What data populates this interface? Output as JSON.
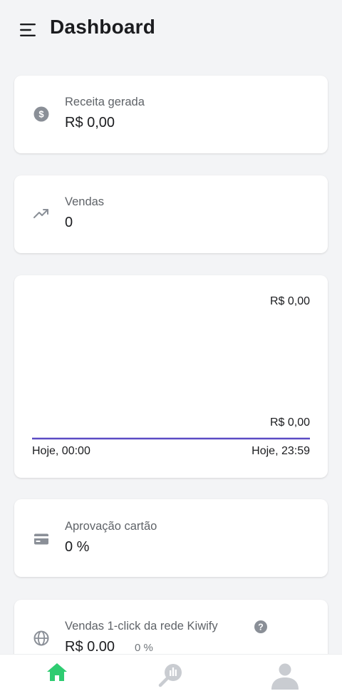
{
  "header": {
    "title": "Dashboard",
    "menu_icon": "menu-icon"
  },
  "cards": {
    "receita": {
      "label": "Receita gerada",
      "value": "R$ 0,00",
      "icon": "dollar-circle-icon"
    },
    "vendas": {
      "label": "Vendas",
      "value": "0",
      "icon": "trending-up-icon"
    },
    "aprovacao": {
      "label": "Aprovação cartão",
      "value": "0 %",
      "icon": "credit-card-icon"
    },
    "one_click": {
      "label": "Vendas 1-click da rede Kiwify",
      "value": "R$ 0.00",
      "percent": "0 %",
      "icon": "globe-icon",
      "help_icon": "help-circle-icon"
    }
  },
  "chart_data": {
    "type": "line",
    "x": [
      "Hoje, 00:00",
      "Hoje, 23:59"
    ],
    "series": [
      {
        "values": [
          0,
          0
        ]
      }
    ],
    "y_tick_labels": [
      "R$ 0,00",
      "R$ 0,00"
    ],
    "line_color": "#5b4bc4"
  },
  "bottom_nav": {
    "items": [
      {
        "icon": "home-icon",
        "active": true
      },
      {
        "icon": "analytics-icon",
        "active": false
      },
      {
        "icon": "user-icon",
        "active": false
      }
    ],
    "active_color": "#2ecc71",
    "inactive_color": "#c9ccd1"
  }
}
